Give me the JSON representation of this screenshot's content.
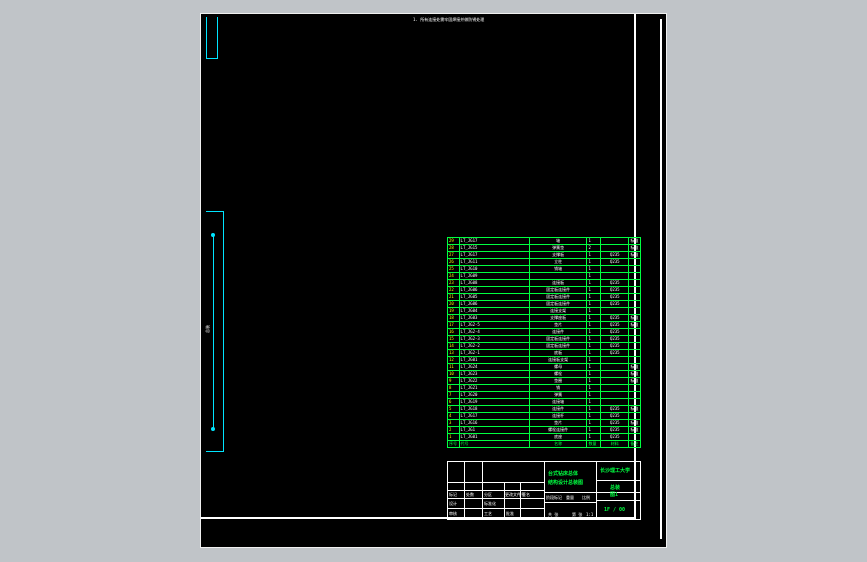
{
  "drawing": {
    "top_note": "1. 所有连接处需牢固焊接并做防锈处理",
    "side_text": "总装"
  },
  "bom": {
    "rows": [
      {
        "no": "29",
        "code": "LT_JG17",
        "name": "轴",
        "qty": "1",
        "material": "",
        "note": "标准"
      },
      {
        "no": "28",
        "code": "LT_JG15",
        "name": "弹簧垫",
        "qty": "2",
        "material": "",
        "note": "标准"
      },
      {
        "no": "27",
        "code": "LT_JG17",
        "name": "支撑板",
        "qty": "1",
        "material": "Q235",
        "note": "标准"
      },
      {
        "no": "26",
        "code": "LT_JG11",
        "name": "立柱",
        "qty": "1",
        "material": "Q235",
        "note": ""
      },
      {
        "no": "25",
        "code": "LT_JG10",
        "name": "销轴",
        "qty": "1",
        "material": "",
        "note": ""
      },
      {
        "no": "24",
        "code": "LT_JG09",
        "name": "",
        "qty": "1",
        "material": "",
        "note": ""
      },
      {
        "no": "23",
        "code": "LT_JG08",
        "name": "连接板",
        "qty": "1",
        "material": "Q235",
        "note": ""
      },
      {
        "no": "22",
        "code": "LT_JG06",
        "name": "固定板连接件",
        "qty": "1",
        "material": "Q235",
        "note": ""
      },
      {
        "no": "21",
        "code": "LT_JG05",
        "name": "固定板连接件",
        "qty": "1",
        "material": "Q235",
        "note": ""
      },
      {
        "no": "20",
        "code": "LT_JG06",
        "name": "固定板连接件",
        "qty": "1",
        "material": "Q235",
        "note": ""
      },
      {
        "no": "19",
        "code": "LT_JG04",
        "name": "连接支架",
        "qty": "1",
        "material": "",
        "note": ""
      },
      {
        "no": "18",
        "code": "LT_JG03",
        "name": "支撑座板",
        "qty": "1",
        "material": "Q235",
        "note": "标准"
      },
      {
        "no": "17",
        "code": "LT_JG2-5",
        "name": "垫片",
        "qty": "1",
        "material": "Q235",
        "note": "标准"
      },
      {
        "no": "16",
        "code": "LT_JG2-4",
        "name": "连接件",
        "qty": "1",
        "material": "Q235",
        "note": ""
      },
      {
        "no": "15",
        "code": "LT_JG2-3",
        "name": "固定板连接件",
        "qty": "1",
        "material": "Q235",
        "note": ""
      },
      {
        "no": "14",
        "code": "LT_JG2-2",
        "name": "固定板连接件",
        "qty": "1",
        "material": "Q235",
        "note": ""
      },
      {
        "no": "13",
        "code": "LT_JG2-1",
        "name": "底板",
        "qty": "1",
        "material": "Q235",
        "note": ""
      },
      {
        "no": "12",
        "code": "LT_JG01",
        "name": "连接板支架",
        "qty": "1",
        "material": "",
        "note": ""
      },
      {
        "no": "11",
        "code": "LT_JG24",
        "name": "螺母",
        "qty": "1",
        "material": "",
        "note": "标准"
      },
      {
        "no": "10",
        "code": "LT_JG23",
        "name": "螺栓",
        "qty": "1",
        "material": "",
        "note": "标准"
      },
      {
        "no": "9",
        "code": "LT_JG22",
        "name": "垫圈",
        "qty": "1",
        "material": "",
        "note": "标准"
      },
      {
        "no": "8",
        "code": "LT_JG21",
        "name": "销",
        "qty": "1",
        "material": "",
        "note": ""
      },
      {
        "no": "7",
        "code": "LT_JG20",
        "name": "弹簧",
        "qty": "1",
        "material": "",
        "note": ""
      },
      {
        "no": "6",
        "code": "LT_JG19",
        "name": "连接轴",
        "qty": "1",
        "material": "",
        "note": ""
      },
      {
        "no": "5",
        "code": "LT_JG18",
        "name": "连接件",
        "qty": "1",
        "material": "Q235",
        "note": "标准"
      },
      {
        "no": "4",
        "code": "LT_JG17",
        "name": "连接杆",
        "qty": "1",
        "material": "Q235",
        "note": ""
      },
      {
        "no": "3",
        "code": "LT_JG16",
        "name": "垫片",
        "qty": "1",
        "material": "Q235",
        "note": "标准"
      },
      {
        "no": "2",
        "code": "LT_JG1",
        "name": "螺栓连接件",
        "qty": "1",
        "material": "Q235",
        "note": "标准"
      },
      {
        "no": "1",
        "code": "LT_JG01",
        "name": "底座",
        "qty": "1",
        "material": "Q235",
        "note": ""
      }
    ],
    "header": {
      "no": "序号",
      "code": "代号",
      "name": "名称",
      "qty": "数量",
      "material": "材料",
      "note": "备注"
    }
  },
  "title_block": {
    "drawing_name_1": "台式钻床总体",
    "drawing_name_2": "结构设计总装图",
    "school": "长沙理工大学",
    "drawing_no": "总装",
    "sub_no": "图1",
    "scale": "1:1",
    "sheet": "1F / 00",
    "labels": [
      "标记",
      "处数",
      "分区",
      "更改文件号",
      "签名",
      "年月日",
      "设计",
      "标准化",
      "审核",
      "工艺",
      "批准",
      "阶段标记",
      "重量",
      "比例",
      "共 张",
      "第 张"
    ]
  },
  "colors": {
    "bom_border": "#00ff40",
    "cyan": "#00e5ff",
    "background": "#000000"
  }
}
